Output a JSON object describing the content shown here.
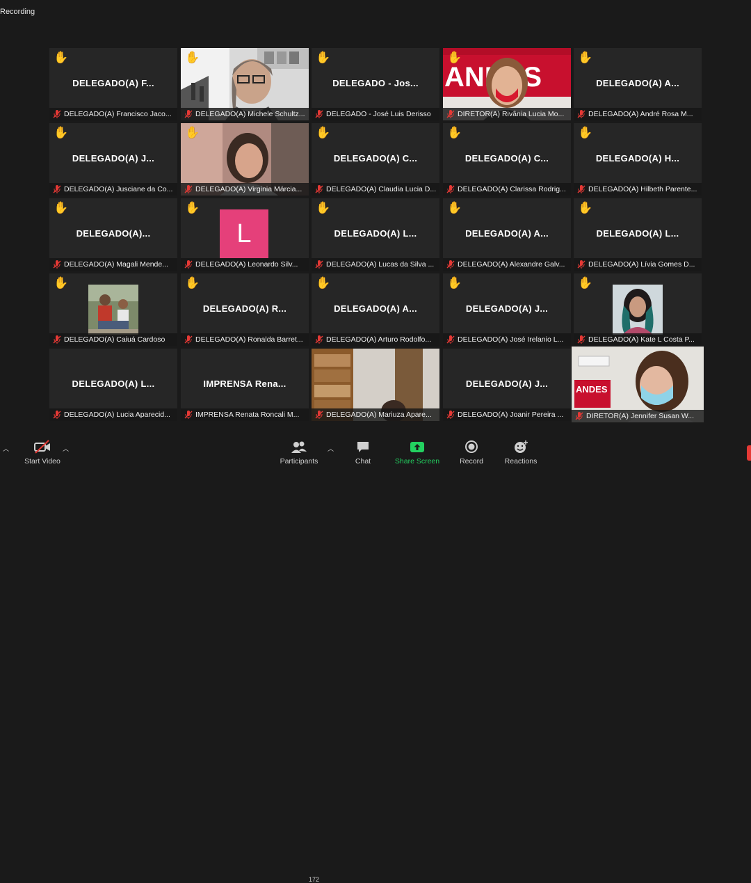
{
  "recording_label": "Recording",
  "colors": {
    "background": "#1a1a1a",
    "tile": "#262626",
    "active_border": "#c9d94a",
    "share_green": "#23d160",
    "avatar_pink": "#e5407a",
    "muted_red": "#e53935"
  },
  "tiles": [
    {
      "label": "DELEGADO(A)  F...",
      "name": "DELEGADO(A) Francisco Jaco...",
      "hand": true,
      "kind": "text"
    },
    {
      "label": "",
      "name": "DELEGADO(A) Michele Schultz...",
      "hand": true,
      "kind": "video"
    },
    {
      "label": "DELEGADO - Jos...",
      "name": "DELEGADO - José Luis Derisso",
      "hand": true,
      "kind": "text"
    },
    {
      "label": "",
      "name": "DIRETOR(A) Rivânia Lucia Mo...",
      "hand": true,
      "kind": "video"
    },
    {
      "label": "DELEGADO(A)  A...",
      "name": "DELEGADO(A) André Rosa M...",
      "hand": true,
      "kind": "text"
    },
    {
      "label": "DELEGADO(A)  J...",
      "name": "DELEGADO(A) Jusciane da Co...",
      "hand": true,
      "kind": "text"
    },
    {
      "label": "",
      "name": "DELEGADO(A) Virginia Márcia...",
      "hand": true,
      "kind": "video"
    },
    {
      "label": "DELEGADO(A)  C...",
      "name": "DELEGADO(A) Claudia Lucia D...",
      "hand": true,
      "kind": "text"
    },
    {
      "label": "DELEGADO(A)  C...",
      "name": "DELEGADO(A) Clarissa Rodrig...",
      "hand": true,
      "kind": "text"
    },
    {
      "label": "DELEGADO(A)  H...",
      "name": "DELEGADO(A) Hilbeth Parente...",
      "hand": true,
      "kind": "text"
    },
    {
      "label": "DELEGADO(A)...",
      "name": "DELEGADO(A) Magali Mende...",
      "hand": true,
      "kind": "text"
    },
    {
      "label": "L",
      "name": "DELEGADO(A)  Leonardo Silv...",
      "hand": true,
      "kind": "avatar"
    },
    {
      "label": "DELEGADO(A)  L...",
      "name": "DELEGADO(A) Lucas da Silva ...",
      "hand": true,
      "kind": "text"
    },
    {
      "label": "DELEGADO(A)  A...",
      "name": "DELEGADO(A) Alexandre Galv...",
      "hand": true,
      "kind": "text"
    },
    {
      "label": "DELEGADO(A)  L...",
      "name": "DELEGADO(A) Lívia Gomes D...",
      "hand": true,
      "kind": "text"
    },
    {
      "label": "",
      "name": "DELEGADO(A) Caiuá Cardoso",
      "hand": true,
      "kind": "thumb"
    },
    {
      "label": "DELEGADO(A)  R...",
      "name": "DELEGADO(A) Ronalda Barret...",
      "hand": true,
      "kind": "text"
    },
    {
      "label": "DELEGADO(A)  A...",
      "name": "DELEGADO(A) Arturo Rodolfo...",
      "hand": true,
      "kind": "text"
    },
    {
      "label": "DELEGADO(A)  J...",
      "name": "DELEGADO(A) José Irelanio L...",
      "hand": true,
      "kind": "text"
    },
    {
      "label": "",
      "name": "DELEGADO(A) Kate L Costa P...",
      "hand": true,
      "kind": "thumb"
    },
    {
      "label": "DELEGADO(A)  L...",
      "name": "DELEGADO(A) Lucia Aparecid...",
      "hand": false,
      "kind": "text"
    },
    {
      "label": "IMPRENSA  Rena...",
      "name": "IMPRENSA Renata Roncali M...",
      "hand": false,
      "kind": "text"
    },
    {
      "label": "",
      "name": "DELEGADO(A) Mariuza Apare...",
      "hand": false,
      "kind": "video"
    },
    {
      "label": "DELEGADO(A)  J...",
      "name": "DELEGADO(A) Joanir Pereira ...",
      "hand": false,
      "kind": "text"
    },
    {
      "label": "",
      "name": "DIRETOR(A) Jennifer Susan W...",
      "hand": false,
      "kind": "video",
      "active": true
    }
  ],
  "toolbar": {
    "start_video": "Start Video",
    "participants": "Participants",
    "participant_count": "172",
    "chat": "Chat",
    "share_screen": "Share Screen",
    "record": "Record",
    "reactions": "Reactions"
  }
}
